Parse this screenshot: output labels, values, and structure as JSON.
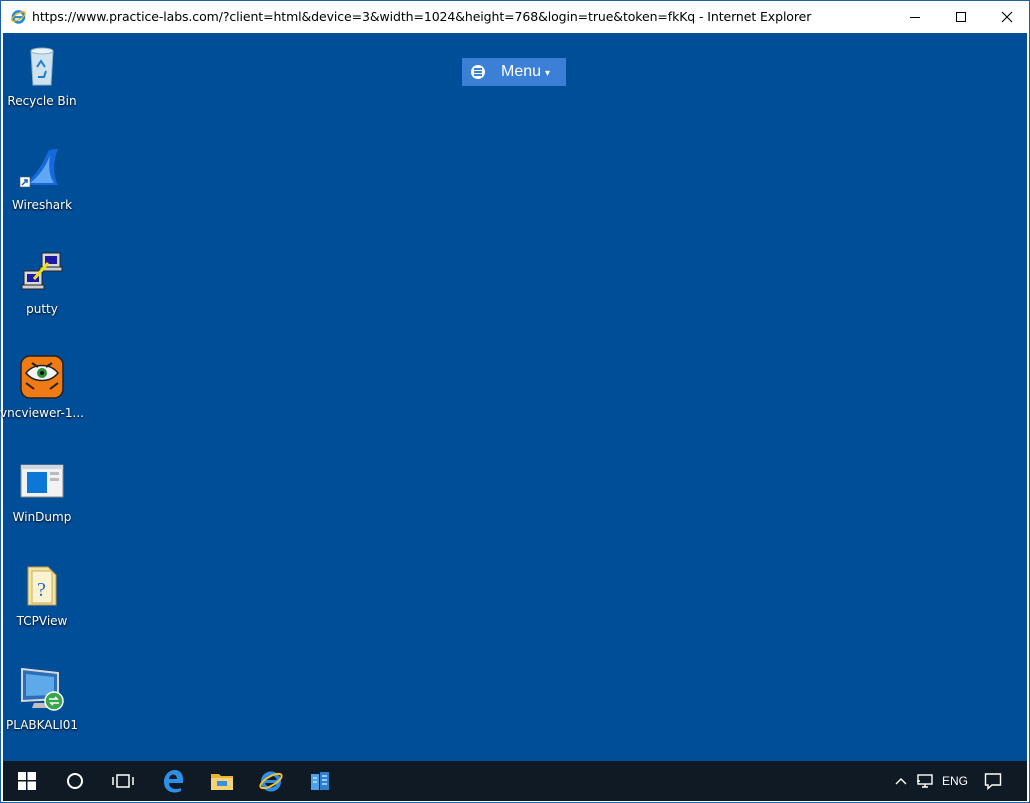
{
  "window": {
    "title": "https://www.practice-labs.com/?client=html&device=3&width=1024&height=768&login=true&token=fkKq - Internet Explorer",
    "minimize_icon": "minimize-icon",
    "maximize_icon": "maximize-icon",
    "close_icon": "close-icon"
  },
  "menu": {
    "label": "Menu",
    "caret": "▾"
  },
  "desktop_icons": [
    {
      "label": "Recycle Bin",
      "icon": "recycle-bin-icon"
    },
    {
      "label": "Wireshark",
      "icon": "wireshark-icon"
    },
    {
      "label": "putty",
      "icon": "putty-icon"
    },
    {
      "label": "vncviewer-1...",
      "icon": "vncviewer-icon"
    },
    {
      "label": "WinDump",
      "icon": "windump-icon"
    },
    {
      "label": "TCPView",
      "icon": "tcpview-icon"
    },
    {
      "label": "PLABKALI01",
      "icon": "remote-desktop-icon"
    }
  ],
  "taskbar": {
    "items": [
      "start-icon",
      "search-circle-icon",
      "task-view-icon",
      "edge-icon",
      "file-explorer-icon",
      "internet-explorer-icon",
      "server-manager-icon"
    ],
    "tray": {
      "language": "ENG"
    }
  },
  "colors": {
    "desktop": "#004e98",
    "taskbar": "#101a25",
    "menu_button": "#3b7fd6"
  }
}
